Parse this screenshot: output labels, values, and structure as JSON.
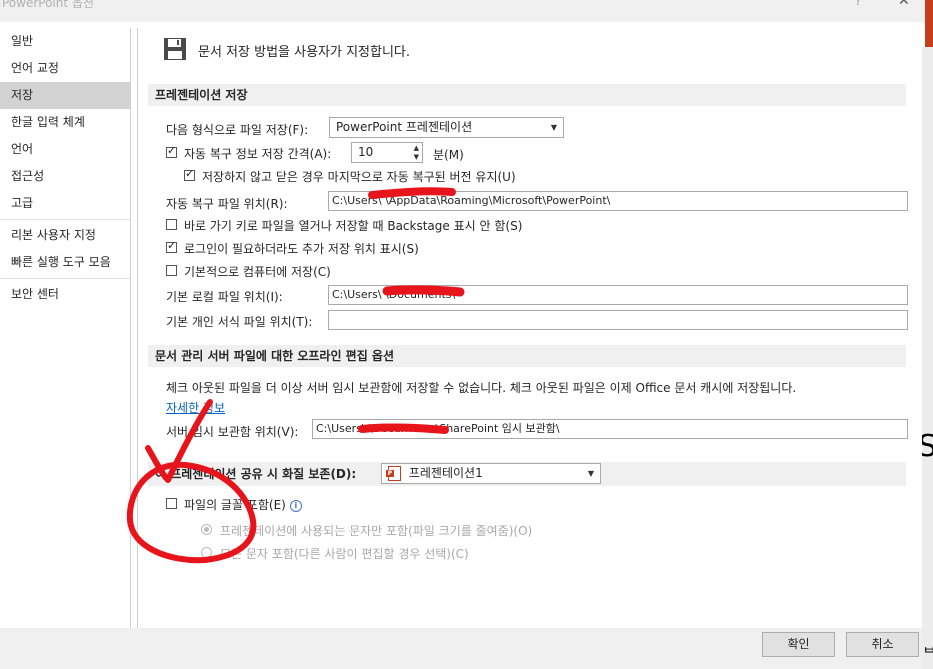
{
  "window": {
    "title": "PowerPoint 옵션",
    "help": "?",
    "close": "✕"
  },
  "nav": {
    "items": [
      {
        "label": "일반"
      },
      {
        "label": "언어 교정"
      },
      {
        "label": "저장"
      },
      {
        "label": "한글 입력 체계"
      },
      {
        "label": "언어"
      },
      {
        "label": "접근성"
      },
      {
        "label": "고급"
      },
      {
        "label": "리본 사용자 지정"
      },
      {
        "label": "빠른 실행 도구 모음"
      },
      {
        "label": "보안 센터"
      }
    ],
    "selected": "저장"
  },
  "header": {
    "text": "문서 저장 방법을 사용자가 지정합니다."
  },
  "save_section": {
    "title": "프레젠테이션 저장",
    "format_label": "다음 형식으로 파일 저장(F):",
    "format_value": "PowerPoint 프레젠테이션",
    "autorecover_label": "자동 복구 정보 저장 간격(A):",
    "autorecover_value": "10",
    "minutes_label": "분(M)",
    "keep_last_label": "저장하지 않고 닫은 경우 마지막으로 자동 복구된 버전 유지(U)",
    "autorecover_path_label": "자동 복구 파일 위치(R):",
    "autorecover_path_value": "C:\\Users\\            \\AppData\\Roaming\\Microsoft\\PowerPoint\\",
    "no_backstage_label": "바로 가기 키로 파일을 열거나 저장할 때 Backstage 표시 안 함(S)",
    "show_locations_label": "로그인이 필요하더라도 추가 저장 위치 표시(S)",
    "save_to_computer_label": "기본적으로 컴퓨터에 저장(C)",
    "local_path_label": "기본 로컬 파일 위치(I):",
    "local_path_value": "C:\\Users\\            \\Documents\\",
    "template_path_label": "기본 개인 서식 파일 위치(T):",
    "template_path_value": ""
  },
  "offline_section": {
    "title": "문서 관리 서버 파일에 대한 오프라인 편집 옵션",
    "description": "체크 아웃된 파일을 더 이상 서버 임시 보관함에 저장할 수 없습니다. 체크 아웃된 파일은 이제 Office 문서 캐시에 저장됩니다.",
    "more_info": "자세한 정보",
    "drafts_label": "서버 임시 보관함 위치(V):",
    "drafts_value": "C:\\Users\\            \\Documents\\SharePoint 임시 보관함\\"
  },
  "fidelity_section": {
    "title": "이 프레젠테이션 공유 시 화질 보존(D):",
    "presentation_value": "프레젠테이션1",
    "embed_fonts_label": "파일의 글꼴 포함(E)",
    "embed_used_label": "프레젠테이션에 사용되는 문자만 포함(파일 크기를 줄여줌)(O)",
    "embed_all_label": "모든 문자 포함(다른 사람이 편집할 경우 선택)(C)"
  },
  "footer": {
    "ok": "확인",
    "cancel": "취소"
  },
  "colors": {
    "accent": "#c43e1c",
    "link": "#0563c1",
    "selected_nav": "#d3d3d3",
    "scribble": "#e8141c"
  },
  "checkbox_states": {
    "autorecover": true,
    "keep_last": true,
    "no_backstage": false,
    "show_locations": true,
    "save_to_computer": false,
    "embed_fonts": false
  }
}
